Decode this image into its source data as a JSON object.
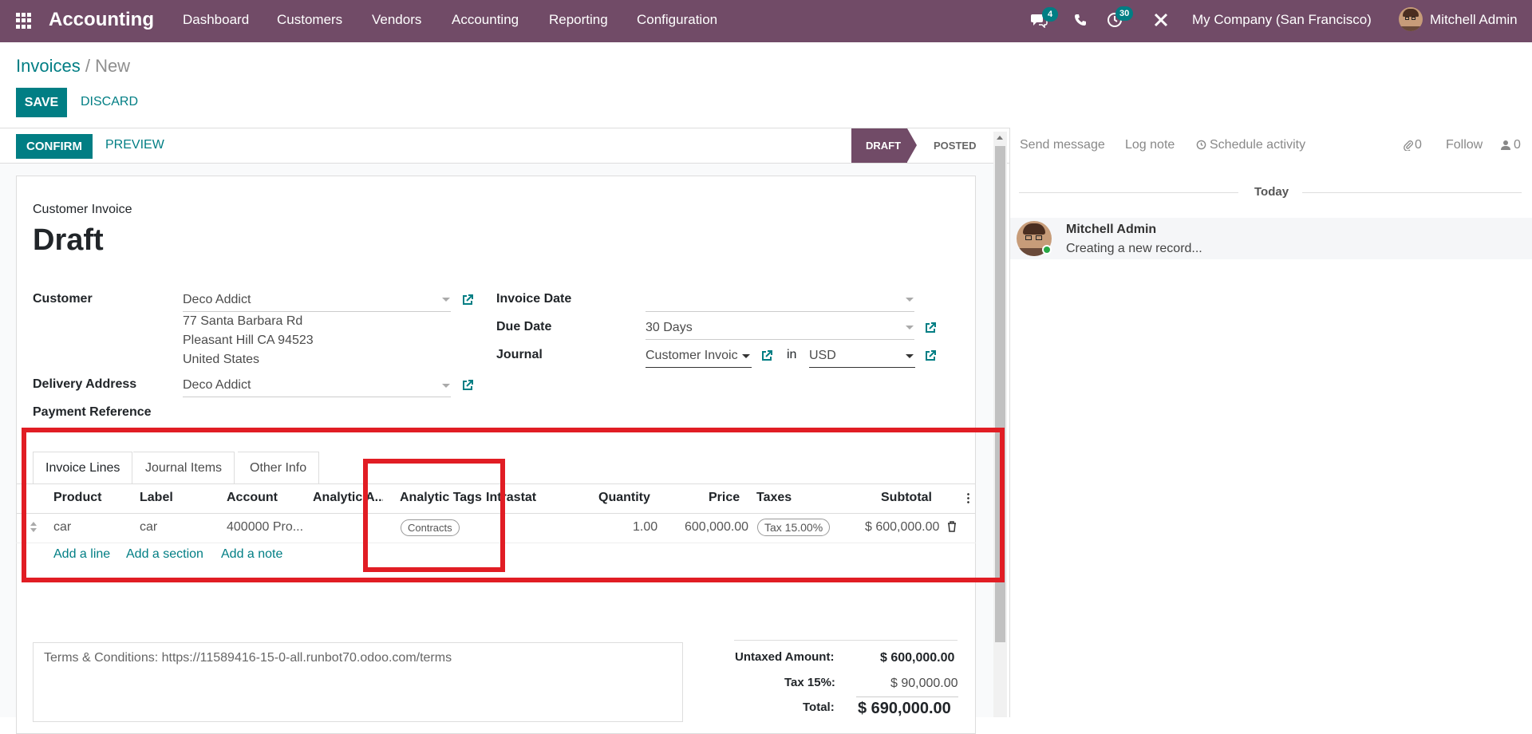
{
  "topbar": {
    "app_name": "Accounting",
    "menu": [
      "Dashboard",
      "Customers",
      "Vendors",
      "Accounting",
      "Reporting",
      "Configuration"
    ],
    "chat_badge": "4",
    "activity_badge": "30",
    "company": "My Company (San Francisco)",
    "user": "Mitchell Admin",
    "icons": [
      "apps-grid-icon",
      "chat-icon",
      "phone-icon",
      "clock-icon",
      "tools-icon"
    ]
  },
  "breadcrumb": {
    "parent": "Invoices",
    "separator": " / ",
    "current": "New"
  },
  "control": {
    "save_label": "SAVE",
    "discard_label": "DISCARD"
  },
  "statusbar": {
    "confirm_label": "CONFIRM",
    "preview_label": "PREVIEW",
    "stages": [
      "DRAFT",
      "POSTED"
    ],
    "active_stage": "DRAFT"
  },
  "form": {
    "type_label": "Customer Invoice",
    "state_title": "Draft",
    "customer_label": "Customer",
    "customer_value": "Deco Addict",
    "address_lines": [
      "77 Santa Barbara Rd",
      "Pleasant Hill CA 94523",
      "United States"
    ],
    "delivery_label": "Delivery Address",
    "delivery_value": "Deco Addict",
    "payment_ref_label": "Payment Reference",
    "invoice_date_label": "Invoice Date",
    "invoice_date_value": "",
    "due_date_label": "Due Date",
    "due_date_value": "30 Days",
    "journal_label": "Journal",
    "journal_value": "Customer Invoic",
    "in_label": "in",
    "currency_value": "USD"
  },
  "tabs": [
    "Invoice Lines",
    "Journal Items",
    "Other Info"
  ],
  "active_tab": "Invoice Lines",
  "lines_table": {
    "columns": [
      "Product",
      "Label",
      "Account",
      "Analytic A...",
      "Analytic Tags",
      "Intrastat",
      "Quantity",
      "Price",
      "Taxes",
      "Subtotal"
    ],
    "rows": [
      {
        "product": "car",
        "label": "car",
        "account": "400000 Pro...",
        "analytic_account": "",
        "analytic_tags": "Contracts",
        "intrastat": "",
        "quantity": "1.00",
        "price": "600,000.00",
        "taxes": "Tax 15.00%",
        "subtotal": "$ 600,000.00"
      }
    ],
    "add_line": "Add a line",
    "add_section": "Add a section",
    "add_note": "Add a note"
  },
  "terms": "Terms & Conditions: https://11589416-15-0-all.runbot70.odoo.com/terms",
  "totals": {
    "untaxed_label": "Untaxed Amount:",
    "untaxed_value": "$ 600,000.00",
    "tax_label": "Tax 15%:",
    "tax_value": "$ 90,000.00",
    "total_label": "Total:",
    "total_value": "$ 690,000.00"
  },
  "chatter": {
    "send_message": "Send message",
    "log_note": "Log note",
    "schedule_activity": "Schedule activity",
    "attachments_count": "0",
    "follow": "Follow",
    "followers_count": "0",
    "date_separator": "Today",
    "message_author": "Mitchell Admin",
    "message_body": "Creating a new record..."
  },
  "colors": {
    "brand": "#714b67",
    "accent": "#017e84",
    "highlight": "#e11d24"
  }
}
